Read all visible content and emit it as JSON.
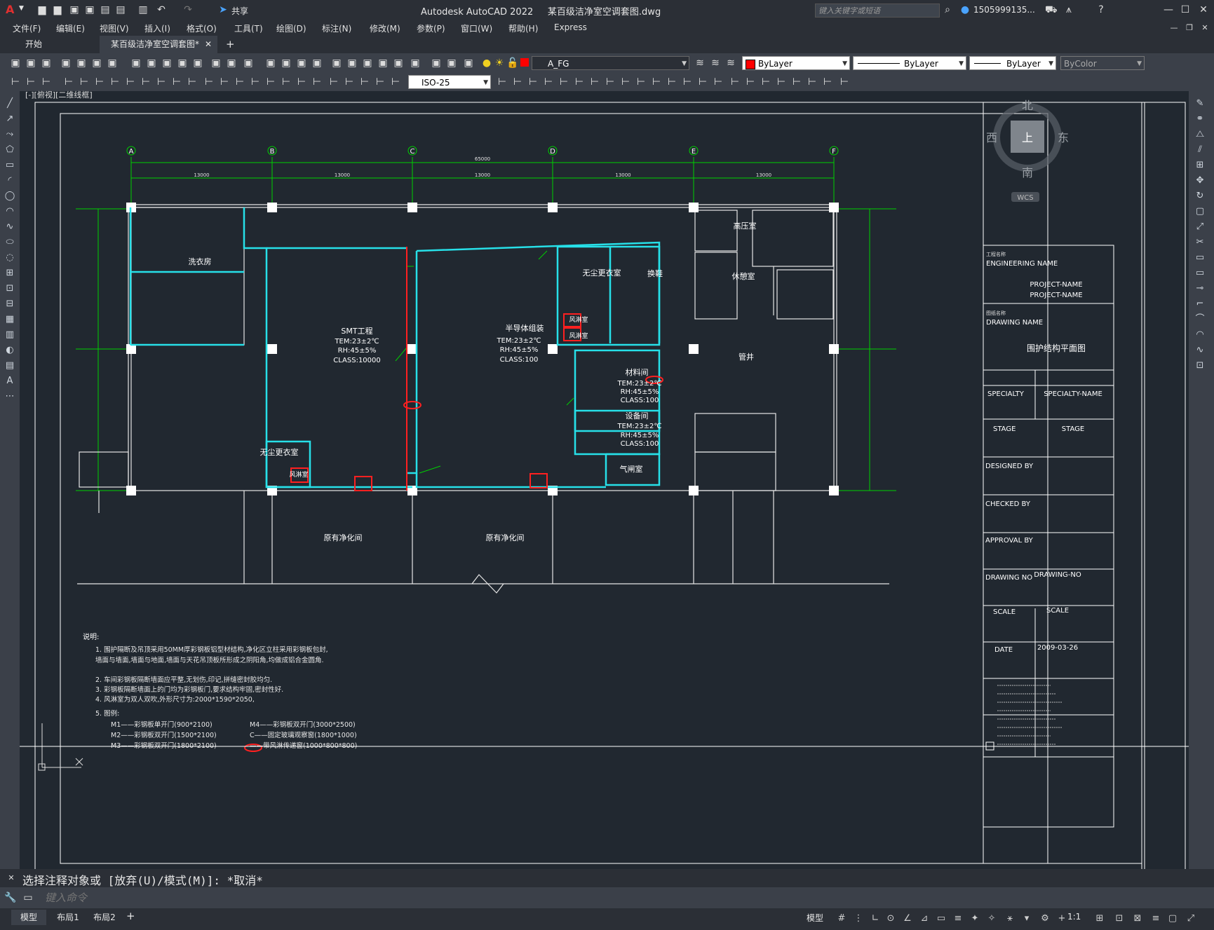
{
  "app": {
    "title": "Autodesk AutoCAD 2022",
    "file_title": "某百级洁净室空调套图.dwg",
    "share_label": "共享",
    "search_placeholder": "键入关键字或短语",
    "user": "1505999135..."
  },
  "menu": [
    "文件(F)",
    "编辑(E)",
    "视图(V)",
    "插入(I)",
    "格式(O)",
    "工具(T)",
    "绘图(D)",
    "标注(N)",
    "修改(M)",
    "参数(P)",
    "窗口(W)",
    "帮助(H)",
    "Express"
  ],
  "tabs": {
    "start": "开始",
    "drawing": "某百级洁净室空调套图*"
  },
  "toolbar": {
    "layer": "A_FG",
    "color": "ByLayer",
    "linetype": "ByLayer",
    "lineweight": "ByLayer",
    "plotstyle": "ByColor",
    "dimstyle": "ISO-25"
  },
  "viewport_label": "[-][俯视][二维线框]",
  "viewcube": {
    "north": "北",
    "south": "南",
    "east": "东",
    "west": "西",
    "top": "上",
    "wcs": "WCS"
  },
  "drawing": {
    "grid_labels": [
      "A",
      "B",
      "C",
      "D",
      "E",
      "F"
    ],
    "total_dim": "65000",
    "bay_dims": [
      "13000",
      "13000",
      "13000",
      "13000",
      "13000"
    ],
    "rooms": {
      "laundry": "洗衣房",
      "smt_title": "SMT工程",
      "smt_tem": "TEM:23±2℃",
      "smt_rh": "RH:45±5%",
      "smt_class": "CLASS:10000",
      "semi_title": "半导体组装",
      "semi_tem": "TEM:23±2℃",
      "semi_rh": "RH:45±5%",
      "semi_class": "CLASS:100",
      "gown1": "无尘更衣室",
      "shoe": "换鞋",
      "shower1": "风淋室",
      "shower2": "风淋室",
      "shower3": "风淋室",
      "hv": "高压室",
      "rest": "休憩室",
      "shaft": "管井",
      "material_title": "材料间",
      "material_tem": "TEM:23±2℃",
      "material_rh": "RH:45±5%",
      "material_class": "CLASS:100",
      "equip_title": "设备间",
      "equip_tem": "TEM:23±2℃",
      "equip_rh": "RH:45±5%",
      "equip_class": "CLASS:100",
      "airlock": "气闸室",
      "gown2": "无尘更衣室",
      "existing1": "原有净化间",
      "existing2": "原有净化间"
    },
    "notes_title": "说明:",
    "notes": [
      "1.   围护隔断及吊顶采用50MM厚彩钢板铝型材结构,净化区立柱采用彩钢板包封,",
      "      墙面与墙面,墙面与地面,墙面与天花吊顶板所形成之阴阳角,均做成铝合金圆角.",
      "2.   车间彩钢板隔断墙面应平整,无划伤,印记,拼缝密封胶均匀.",
      "3.   彩钢板隔断墙面上的门均为彩钢板门,要求结构牢固,密封性好.",
      "4.   风淋室为双人双吹,外形尺寸为:2000*1590*2050,",
      "5.   图例:"
    ],
    "legend_left": [
      "M1——彩钢板单开门(900*2100)",
      "M2——彩钢板双开门(1500*2100)",
      "M3——彩钢板双开门(1800*2100)"
    ],
    "legend_right": [
      "M4——彩钢板双开门(3000*2500)",
      "C——固定玻璃观察窗(1800*1000)",
      "——带风淋传递窗(1000*800*800)"
    ]
  },
  "titleblock": {
    "eng_label_cn": "工程名称",
    "eng_label": "ENGINEERING NAME",
    "project1": "PROJECT-NAME",
    "project2": "PROJECT-NAME",
    "dwg_label_cn": "图纸名称",
    "dwg_label": "DRAWING NAME",
    "dwg_name": "围护结构平面图",
    "specialty_label": "SPECIALTY",
    "specialty": "SPECIALTY-NAME",
    "stage_label": "STAGE",
    "stage": "STAGE",
    "designed": "DESIGNED BY",
    "checked": "CHECKED BY",
    "approval": "APPROVAL BY",
    "drawing_no_label": "DRAWING NO",
    "drawing_no": "DRAWING-NO",
    "scale_label": "SCALE",
    "scale": "SCALE",
    "date_label": "DATE",
    "date": "2009-03-26"
  },
  "command": {
    "history": "选择注释对象或 [放弃(U)/模式(M)]: *取消*",
    "placeholder": "键入命令"
  },
  "layouts": [
    "模型",
    "布局1",
    "布局2"
  ],
  "status": {
    "model": "模型",
    "scale": "1:1"
  }
}
